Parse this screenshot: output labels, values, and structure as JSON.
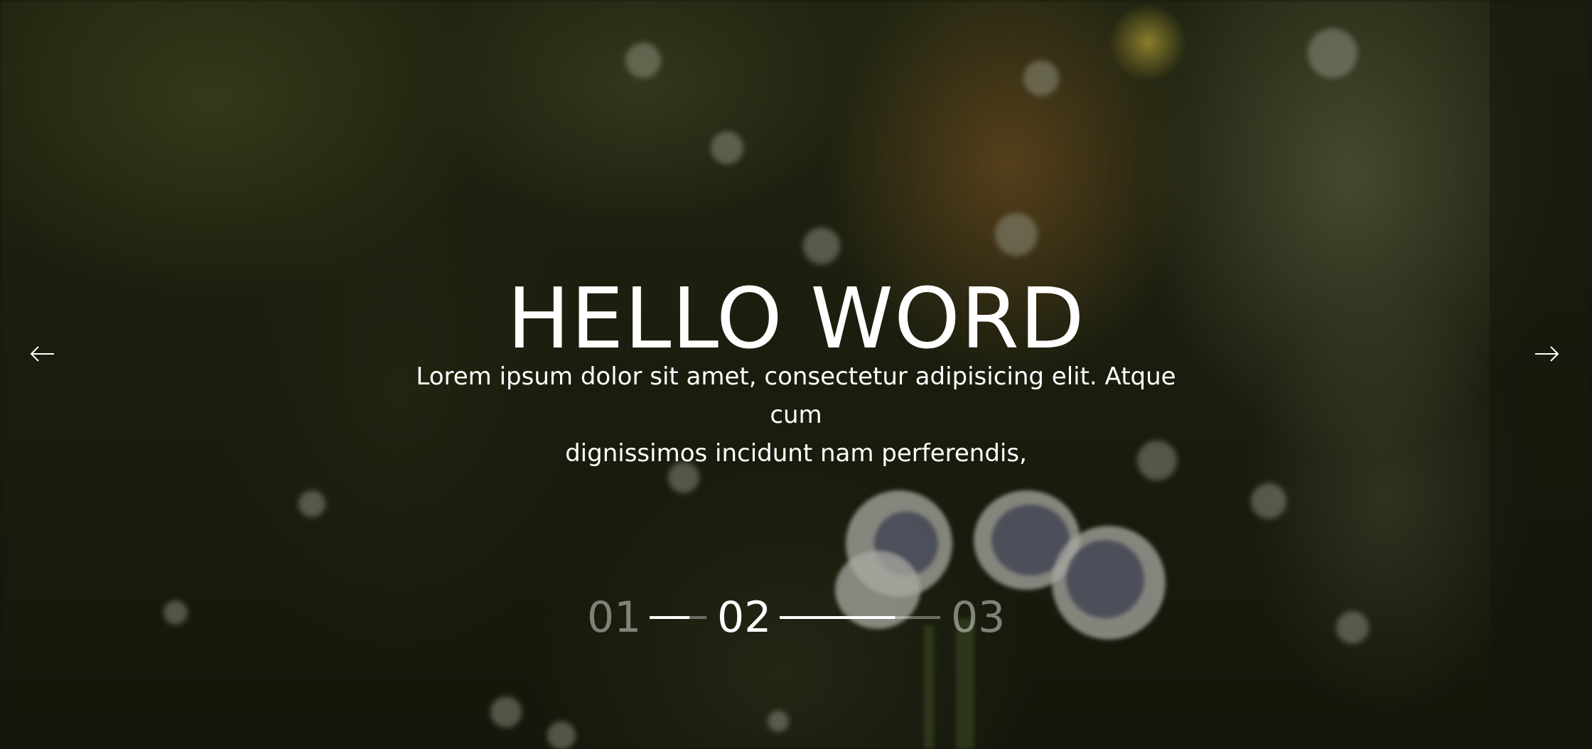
{
  "hero": {
    "title": "HELLO WORD",
    "subtitle_line1": "Lorem ipsum dolor sit amet, consectetur adipisicing elit. Atque cum",
    "subtitle_line2": "dignissimos incidunt nam perferendis,"
  },
  "navigation": {
    "prev_icon": "arrow-left-icon",
    "next_icon": "arrow-right-icon"
  },
  "pager": {
    "current_index": 2,
    "slides": [
      {
        "label": "01",
        "active": false
      },
      {
        "label": "02",
        "active": true
      },
      {
        "label": "03",
        "active": false
      }
    ],
    "progress": [
      1.0,
      0.72
    ]
  },
  "colors": {
    "text": "#ffffff",
    "inactive_text": "rgba(255,255,255,0.45)"
  }
}
